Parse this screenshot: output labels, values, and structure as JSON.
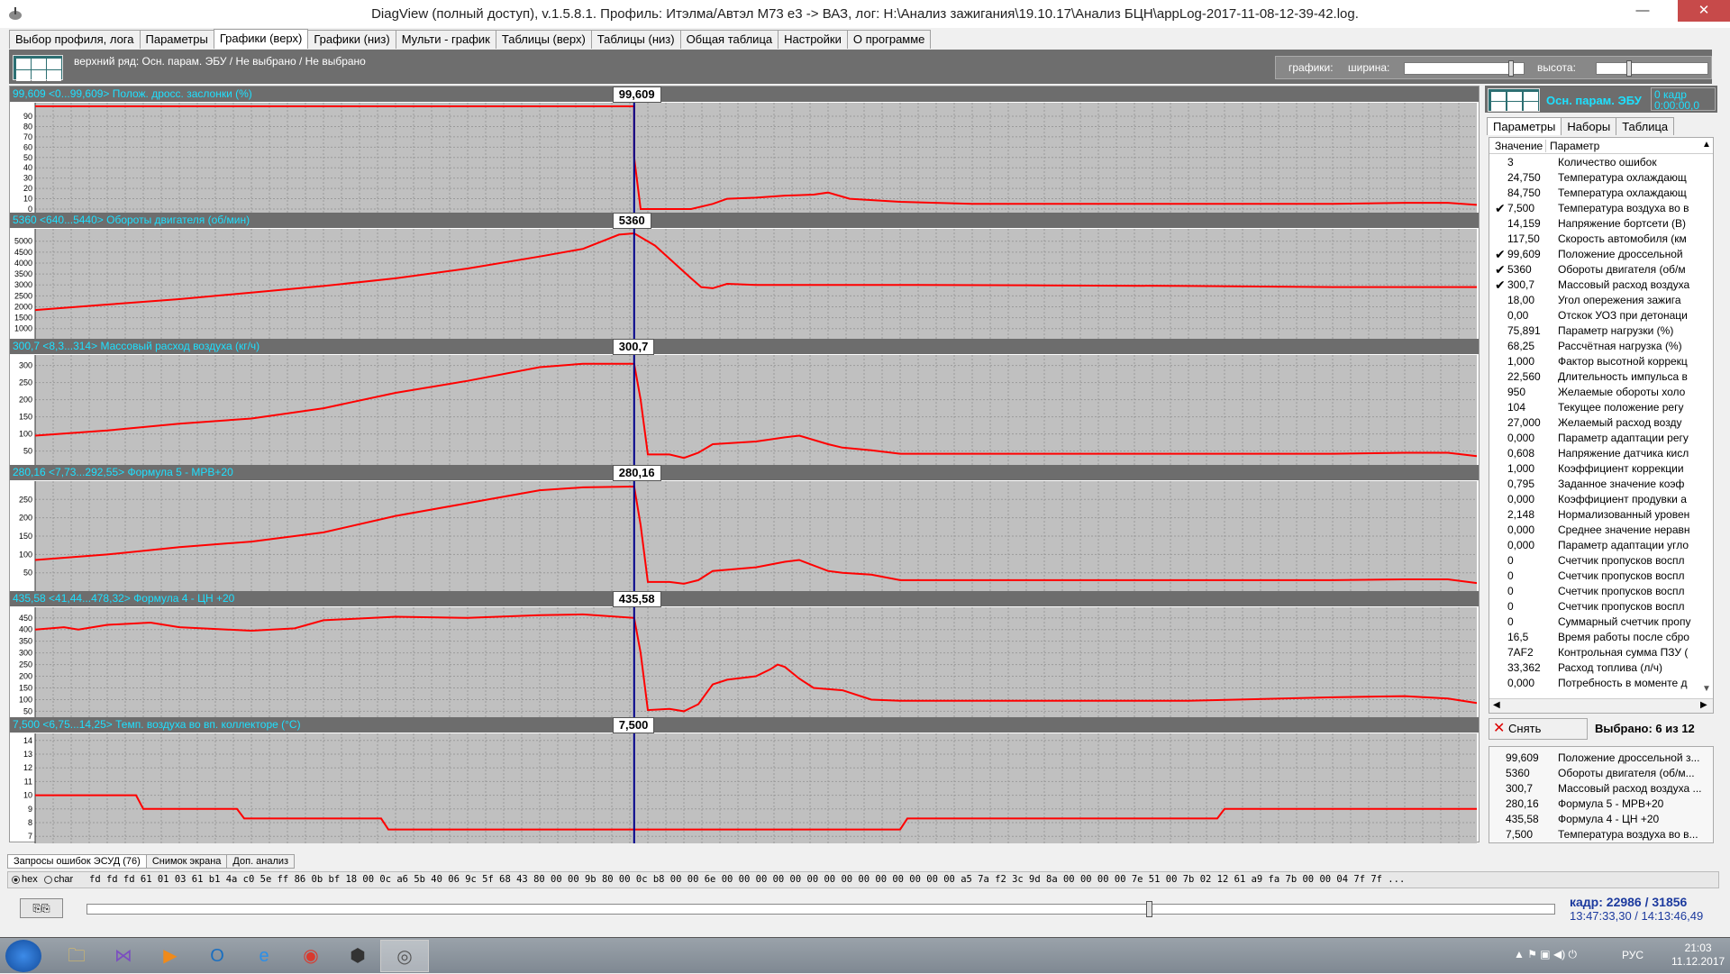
{
  "window": {
    "title": "DiagView (полный доступ), v.1.5.8.1. Профиль: Итэлма/Автэл M73 e3 -> ВАЗ,   лог: H:\\Анализ зажигания\\19.10.17\\Анализ БЦН\\appLog-2017-11-08-12-39-42.log.",
    "min_glyph": "—",
    "max_glyph": "☐",
    "close_glyph": "✕"
  },
  "tabs": [
    {
      "label": "Выбор профиля, лога"
    },
    {
      "label": "Параметры"
    },
    {
      "label": "Графики (верх)"
    },
    {
      "label": "Графики (низ)"
    },
    {
      "label": "Мульти - график"
    },
    {
      "label": "Таблицы (верх)"
    },
    {
      "label": "Таблицы (низ)"
    },
    {
      "label": "Общая таблица"
    },
    {
      "label": "Настройки"
    },
    {
      "label": "О программе"
    }
  ],
  "active_tab": "Графики (верх)",
  "topbar": {
    "row_label": "верхний ряд: Осн. парам. ЭБУ / Не выбрано / Не выбрано",
    "graphs_label": "графики:",
    "width_label": "ширина:",
    "height_label": "высота:",
    "width_value": 0.91,
    "height_value": 0.28
  },
  "cursor_fraction": 0.4155,
  "colors": {
    "header_text": "#1ee0ff",
    "line": "#ff0000",
    "cursor": "#00008b",
    "plot_bg": "#c0c0c0",
    "grid": "#9a9a9a"
  },
  "panels": [
    {
      "value": "99,609",
      "range": "<0...99,609>",
      "name": "Полож. дросс. заслонки (%)",
      "ticks": [
        90,
        80,
        70,
        60,
        50,
        40,
        30,
        20,
        10,
        0
      ],
      "ymin": 0,
      "ymax": 99.609,
      "points": [
        [
          0,
          99.6
        ],
        [
          0.4155,
          99.6
        ],
        [
          0.4155,
          50
        ],
        [
          0.42,
          0
        ],
        [
          0.455,
          0
        ],
        [
          0.47,
          5
        ],
        [
          0.48,
          10
        ],
        [
          0.5,
          11
        ],
        [
          0.52,
          13
        ],
        [
          0.54,
          14
        ],
        [
          0.55,
          16
        ],
        [
          0.565,
          10
        ],
        [
          0.6,
          7
        ],
        [
          0.65,
          5
        ],
        [
          0.7,
          5
        ],
        [
          0.8,
          5
        ],
        [
          0.9,
          5
        ],
        [
          0.95,
          6
        ],
        [
          0.98,
          6
        ],
        [
          1,
          4
        ]
      ]
    },
    {
      "value": "5360",
      "range": "<640...5440>",
      "name": "Обороты двигателя (об/мин)",
      "ticks": [
        5000,
        4500,
        4000,
        3500,
        3000,
        2500,
        2000,
        1500,
        1000
      ],
      "ymin": 700,
      "ymax": 5400,
      "points": [
        [
          0,
          1850
        ],
        [
          0.05,
          2100
        ],
        [
          0.1,
          2350
        ],
        [
          0.15,
          2650
        ],
        [
          0.2,
          2950
        ],
        [
          0.25,
          3300
        ],
        [
          0.3,
          3750
        ],
        [
          0.35,
          4300
        ],
        [
          0.38,
          4650
        ],
        [
          0.405,
          5300
        ],
        [
          0.4155,
          5360
        ],
        [
          0.43,
          4800
        ],
        [
          0.445,
          3900
        ],
        [
          0.455,
          3300
        ],
        [
          0.462,
          2900
        ],
        [
          0.47,
          2850
        ],
        [
          0.48,
          3050
        ],
        [
          0.5,
          3000
        ],
        [
          0.6,
          3000
        ],
        [
          0.7,
          2980
        ],
        [
          0.8,
          2950
        ],
        [
          0.9,
          2900
        ],
        [
          1,
          2900
        ]
      ]
    },
    {
      "value": "300,7",
      "range": "<8,3...314>",
      "name": "Массовый расход воздуха (кг/ч)",
      "ticks": [
        300,
        250,
        200,
        150,
        100,
        50
      ],
      "ymin": 20,
      "ymax": 320,
      "points": [
        [
          0,
          95
        ],
        [
          0.05,
          110
        ],
        [
          0.1,
          130
        ],
        [
          0.15,
          145
        ],
        [
          0.2,
          175
        ],
        [
          0.25,
          220
        ],
        [
          0.3,
          255
        ],
        [
          0.35,
          295
        ],
        [
          0.38,
          305
        ],
        [
          0.4155,
          305
        ],
        [
          0.42,
          200
        ],
        [
          0.425,
          40
        ],
        [
          0.44,
          40
        ],
        [
          0.45,
          30
        ],
        [
          0.46,
          45
        ],
        [
          0.47,
          70
        ],
        [
          0.5,
          78
        ],
        [
          0.52,
          90
        ],
        [
          0.53,
          95
        ],
        [
          0.55,
          70
        ],
        [
          0.56,
          60
        ],
        [
          0.58,
          52
        ],
        [
          0.6,
          42
        ],
        [
          0.7,
          42
        ],
        [
          0.8,
          42
        ],
        [
          0.9,
          42
        ],
        [
          0.95,
          45
        ],
        [
          0.98,
          45
        ],
        [
          1,
          35
        ]
      ]
    },
    {
      "value": "280,16",
      "range": "<7,73...292,55>",
      "name": "Формула 5 - МРВ+20",
      "ticks": [
        250,
        200,
        150,
        100,
        50
      ],
      "ymin": 10,
      "ymax": 290,
      "points": [
        [
          0,
          85
        ],
        [
          0.05,
          100
        ],
        [
          0.1,
          120
        ],
        [
          0.15,
          135
        ],
        [
          0.2,
          160
        ],
        [
          0.25,
          205
        ],
        [
          0.3,
          240
        ],
        [
          0.35,
          275
        ],
        [
          0.38,
          283
        ],
        [
          0.4155,
          285
        ],
        [
          0.42,
          180
        ],
        [
          0.425,
          25
        ],
        [
          0.44,
          25
        ],
        [
          0.45,
          20
        ],
        [
          0.46,
          30
        ],
        [
          0.47,
          55
        ],
        [
          0.5,
          65
        ],
        [
          0.52,
          80
        ],
        [
          0.53,
          85
        ],
        [
          0.55,
          55
        ],
        [
          0.56,
          50
        ],
        [
          0.58,
          45
        ],
        [
          0.6,
          30
        ],
        [
          0.7,
          30
        ],
        [
          0.8,
          30
        ],
        [
          0.9,
          30
        ],
        [
          0.95,
          32
        ],
        [
          0.98,
          32
        ],
        [
          1,
          22
        ]
      ]
    },
    {
      "value": "435,58",
      "range": "<41,44...478,32>",
      "name": "Формула 4 - ЦН +20",
      "ticks": [
        450,
        400,
        350,
        300,
        250,
        200,
        150,
        100,
        50
      ],
      "ymin": 40,
      "ymax": 480,
      "points": [
        [
          0,
          400
        ],
        [
          0.02,
          410
        ],
        [
          0.03,
          400
        ],
        [
          0.05,
          420
        ],
        [
          0.08,
          430
        ],
        [
          0.1,
          410
        ],
        [
          0.15,
          395
        ],
        [
          0.18,
          405
        ],
        [
          0.2,
          440
        ],
        [
          0.25,
          455
        ],
        [
          0.3,
          450
        ],
        [
          0.35,
          462
        ],
        [
          0.38,
          465
        ],
        [
          0.4155,
          450
        ],
        [
          0.42,
          300
        ],
        [
          0.425,
          55
        ],
        [
          0.44,
          60
        ],
        [
          0.45,
          50
        ],
        [
          0.46,
          80
        ],
        [
          0.47,
          165
        ],
        [
          0.48,
          185
        ],
        [
          0.5,
          200
        ],
        [
          0.51,
          230
        ],
        [
          0.515,
          250
        ],
        [
          0.52,
          240
        ],
        [
          0.53,
          190
        ],
        [
          0.54,
          150
        ],
        [
          0.56,
          140
        ],
        [
          0.58,
          100
        ],
        [
          0.6,
          95
        ],
        [
          0.7,
          95
        ],
        [
          0.8,
          95
        ],
        [
          0.9,
          110
        ],
        [
          0.95,
          115
        ],
        [
          0.98,
          105
        ],
        [
          1,
          85
        ]
      ]
    },
    {
      "value": "7,500",
      "range": "<6,75...14,25>",
      "name": "Темп. воздуха во вп. коллекторе (°C)",
      "ticks": [
        14,
        13,
        12,
        11,
        10,
        9,
        8,
        7
      ],
      "ymin": 6.75,
      "ymax": 14.25,
      "points": [
        [
          0,
          10
        ],
        [
          0.07,
          10
        ],
        [
          0.075,
          9
        ],
        [
          0.14,
          9
        ],
        [
          0.145,
          8.3
        ],
        [
          0.2,
          8.3
        ],
        [
          0.24,
          8.3
        ],
        [
          0.245,
          7.5
        ],
        [
          0.3,
          7.5
        ],
        [
          0.4155,
          7.5
        ],
        [
          0.5,
          7.5
        ],
        [
          0.6,
          7.5
        ],
        [
          0.605,
          8.3
        ],
        [
          0.7,
          8.3
        ],
        [
          0.82,
          8.3
        ],
        [
          0.825,
          9
        ],
        [
          0.9,
          9
        ],
        [
          1,
          9
        ]
      ]
    }
  ],
  "right_panel": {
    "title": "Осн. парам. ЭБУ",
    "frame_line1": "0 кадр",
    "frame_line2": "0:00:00,0",
    "tabs": [
      "Параметры",
      "Наборы",
      "Таблица"
    ],
    "col_value": "Значение",
    "col_param": "Параметр",
    "rows": [
      {
        "checked": false,
        "value": "3",
        "name": "Количество ошибок"
      },
      {
        "checked": false,
        "value": "24,750",
        "name": "Температура охлаждающ"
      },
      {
        "checked": false,
        "value": "84,750",
        "name": "Температура охлаждающ"
      },
      {
        "checked": true,
        "value": "7,500",
        "name": "Температура воздуха во в"
      },
      {
        "checked": false,
        "value": "14,159",
        "name": "Напряжение бортсети (В)"
      },
      {
        "checked": false,
        "value": "117,50",
        "name": "Скорость автомобиля (км"
      },
      {
        "checked": true,
        "value": "99,609",
        "name": "Положение дроссельной"
      },
      {
        "checked": true,
        "value": "5360",
        "name": "Обороты двигателя (об/м"
      },
      {
        "checked": true,
        "value": "300,7",
        "name": "Массовый расход воздуха"
      },
      {
        "checked": false,
        "value": "18,00",
        "name": "Угол опережения зажига"
      },
      {
        "checked": false,
        "value": "0,00",
        "name": "Отскок УОЗ при детонаци"
      },
      {
        "checked": false,
        "value": "75,891",
        "name": "Параметр нагрузки (%)"
      },
      {
        "checked": false,
        "value": "68,25",
        "name": "Рассчётная нагрузка (%)"
      },
      {
        "checked": false,
        "value": "1,000",
        "name": "Фактор высотной коррекц"
      },
      {
        "checked": false,
        "value": "22,560",
        "name": "Длительность импульса в"
      },
      {
        "checked": false,
        "value": "950",
        "name": "Желаемые обороты холо"
      },
      {
        "checked": false,
        "value": "104",
        "name": "Текущее положение регу"
      },
      {
        "checked": false,
        "value": "27,000",
        "name": "Желаемый расход возду"
      },
      {
        "checked": false,
        "value": "0,000",
        "name": "Параметр адаптации регу"
      },
      {
        "checked": false,
        "value": "0,608",
        "name": "Напряжение датчика кисл"
      },
      {
        "checked": false,
        "value": "1,000",
        "name": "Коэффициент коррекции"
      },
      {
        "checked": false,
        "value": "0,795",
        "name": "Заданное значение коэф"
      },
      {
        "checked": false,
        "value": "0,000",
        "name": "Коэффициент продувки а"
      },
      {
        "checked": false,
        "value": "2,148",
        "name": "Нормализованный уровен"
      },
      {
        "checked": false,
        "value": "0,000",
        "name": "Среднее значение неравн"
      },
      {
        "checked": false,
        "value": "0,000",
        "name": "Параметр адаптации угло"
      },
      {
        "checked": false,
        "value": "0",
        "name": "Счетчик пропусков воспл"
      },
      {
        "checked": false,
        "value": "0",
        "name": "Счетчик пропусков воспл"
      },
      {
        "checked": false,
        "value": "0",
        "name": "Счетчик пропусков воспл"
      },
      {
        "checked": false,
        "value": "0",
        "name": "Счетчик пропусков воспл"
      },
      {
        "checked": false,
        "value": "0",
        "name": "Суммарный счетчик пропу"
      },
      {
        "checked": false,
        "value": "16,5",
        "name": "Время работы после сбро"
      },
      {
        "checked": false,
        "value": "7AF2",
        "name": "Контрольная сумма ПЗУ ("
      },
      {
        "checked": false,
        "value": "33,362",
        "name": "Расход топлива (л/ч)"
      },
      {
        "checked": false,
        "value": "0,000",
        "name": "Потребность в моменте д"
      }
    ],
    "clear_label": "Снять отметки",
    "selected_label": "Выбрано: 6 из 12",
    "summary": [
      {
        "value": "99,609",
        "name": "Положение дроссельной з..."
      },
      {
        "value": "5360",
        "name": "Обороты двигателя (об/м..."
      },
      {
        "value": "300,7",
        "name": "Массовый расход воздуха ..."
      },
      {
        "value": "280,16",
        "name": "Формула 5 - МРВ+20"
      },
      {
        "value": "435,58",
        "name": "Формула 4 - ЦН +20"
      },
      {
        "value": "7,500",
        "name": "Температура воздуха во в..."
      }
    ]
  },
  "bottom_tabs": [
    "Запросы ошибок ЭСУД (76)",
    "Снимок экрана",
    "Доп. анализ"
  ],
  "hex": {
    "hex_label": "hex",
    "char_label": "char",
    "data": "fd fd fd 61 01 03 61 b1 4a c0 5e ff 86 0b bf 18 00 0c a6 5b 40 06 9c 5f 68 43 80 00 00 9b 80 00 0c b8 00 00 6e 00 00 00 00 00 00 00 00 00 00 00 00 00 00 a5 7a f2 3c 9d 8a 00 00 00 00 7e 51 00 7b 02 12 61 a9 fa 7b 00 00 04 7f 7f ..."
  },
  "position": {
    "slider_value": 0.7246,
    "frame_text": "кадр: 22986 / 31856",
    "time_text": "13:47:33,30 / 14:13:46,49"
  },
  "taskbar": {
    "items": [
      "folder-icon",
      "visual-studio-icon",
      "media-player-icon",
      "outlook-icon",
      "internet-explorer-icon",
      "chrome-icon",
      "nox-icon",
      "diagview-icon"
    ],
    "lang": "РУС",
    "time": "21:03",
    "date": "11.12.2017"
  }
}
